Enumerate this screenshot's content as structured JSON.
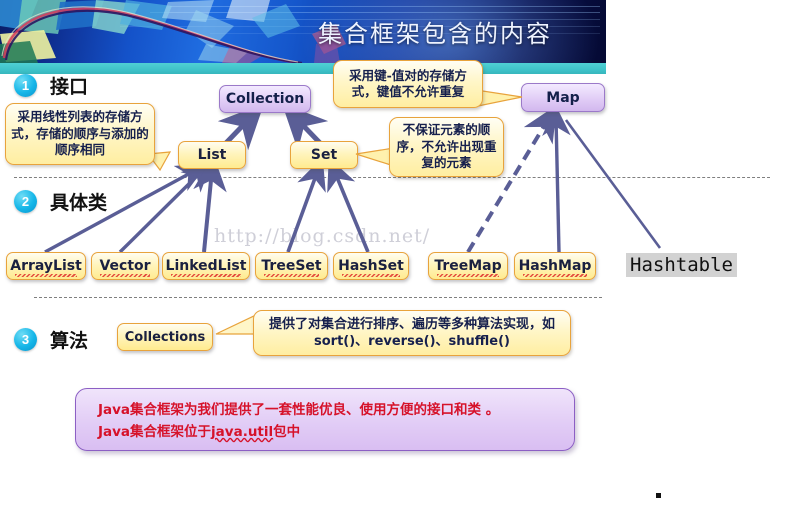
{
  "header": {
    "title": "集合框架包含的内容",
    "banner_gradient_from": "#0a1d66",
    "banner_gradient_to": "#050a33",
    "accent_bar_color": "#4fd0d4"
  },
  "sections": [
    {
      "num": "1",
      "name": "接口"
    },
    {
      "num": "2",
      "name": "具体类"
    },
    {
      "num": "3",
      "name": "算法"
    }
  ],
  "interfaces": [
    {
      "label": "Collection",
      "style": "purple"
    },
    {
      "label": "Map",
      "style": "purple"
    },
    {
      "label": "List",
      "style": "yellow"
    },
    {
      "label": "Set",
      "style": "yellow"
    }
  ],
  "concrete_classes": [
    {
      "label": "ArrayList"
    },
    {
      "label": "Vector"
    },
    {
      "label": "LinkedList"
    },
    {
      "label": "TreeSet"
    },
    {
      "label": "HashSet"
    },
    {
      "label": "TreeMap"
    },
    {
      "label": "HashMap"
    }
  ],
  "legacy_class": {
    "label": "Hashtable"
  },
  "algorithm_class": {
    "label": "Collections"
  },
  "callouts": [
    {
      "id": "list-note",
      "text": "采用线性列表的存储方式，存储的顺序与添加的顺序相同"
    },
    {
      "id": "map-note",
      "text": "采用键-值对的存储方式，键值不允许重复"
    },
    {
      "id": "set-note",
      "text": "不保证元素的顺序，不允许出现重复的元素"
    },
    {
      "id": "collections-note",
      "text": "提供了对集合进行排序、遍历等多种算法实现，如 sort()、reverse()、shuffle()"
    }
  ],
  "summary": {
    "line1": "Java集合框架为我们提供了一套性能优良、使用方便的接口和类 。",
    "line2_prefix": "Java集合框架位于",
    "line2_underlined": "java.util",
    "line2_suffix": "包中",
    "text_color": "#d6122a"
  },
  "watermark": {
    "text": "http://blog.csdn.net/"
  },
  "colors": {
    "node_yellow_fill": "#fff4bd",
    "node_yellow_border": "#e8a33c",
    "node_purple_fill": "#e3d0f7",
    "node_purple_border": "#9b79c9",
    "arrow_color": "#5a5e96",
    "summary_fill": "#e2cdf6",
    "summary_border": "#8c5fc4"
  }
}
